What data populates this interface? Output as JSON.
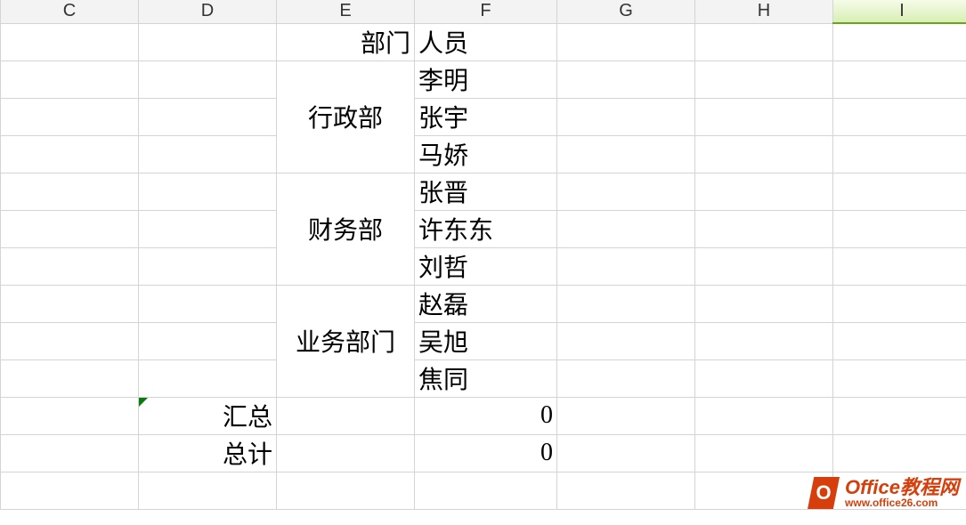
{
  "columns": [
    "C",
    "D",
    "E",
    "F",
    "G",
    "H",
    "I"
  ],
  "selectedColumn": "I",
  "rows": [
    {
      "E": "部门",
      "F": "人员"
    },
    {
      "E_merge": "行政部",
      "F": "李明"
    },
    {
      "F": "张宇"
    },
    {
      "F": "马娇"
    },
    {
      "E_merge": "财务部",
      "F": "张晋"
    },
    {
      "F": "许东东"
    },
    {
      "F": "刘哲"
    },
    {
      "E_merge": "业务部门",
      "F": "赵磊"
    },
    {
      "F": "吴旭"
    },
    {
      "F": "焦同"
    },
    {
      "D": "汇总",
      "F_num": "0"
    },
    {
      "D": "总计",
      "F_num": "0"
    },
    {},
    {}
  ],
  "watermark": {
    "iconLetter": "O",
    "title": "Office教程网",
    "url": "www.office26.com"
  }
}
